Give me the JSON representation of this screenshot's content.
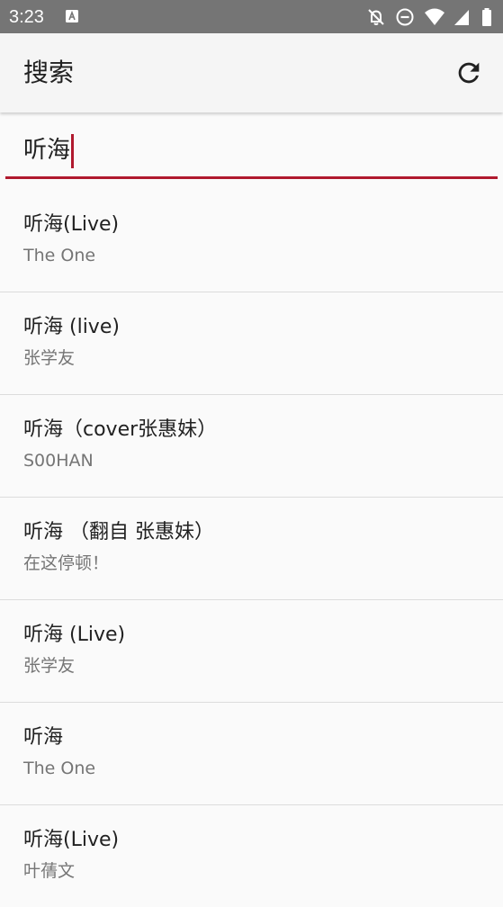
{
  "status_bar": {
    "time": "3:23",
    "icons": [
      "notification-a-icon",
      "bell-off-icon",
      "do-not-disturb-icon",
      "wifi-icon",
      "signal-icon",
      "battery-icon"
    ]
  },
  "app_bar": {
    "title": "搜索",
    "refresh_icon": "refresh-icon"
  },
  "search": {
    "value": "听海",
    "accent_color": "#b0192e"
  },
  "results": [
    {
      "title": "听海(Live)",
      "artist": "The One"
    },
    {
      "title": "听海 (live)",
      "artist": "张学友"
    },
    {
      "title": "听海（cover张惠妹）",
      "artist": "S00HAN"
    },
    {
      "title": "听海 （翻自 张惠妹）",
      "artist": "在这停顿！"
    },
    {
      "title": "听海 (Live)",
      "artist": "张学友"
    },
    {
      "title": "听海",
      "artist": "The One"
    },
    {
      "title": "听海(Live)",
      "artist": "叶蒨文"
    }
  ]
}
